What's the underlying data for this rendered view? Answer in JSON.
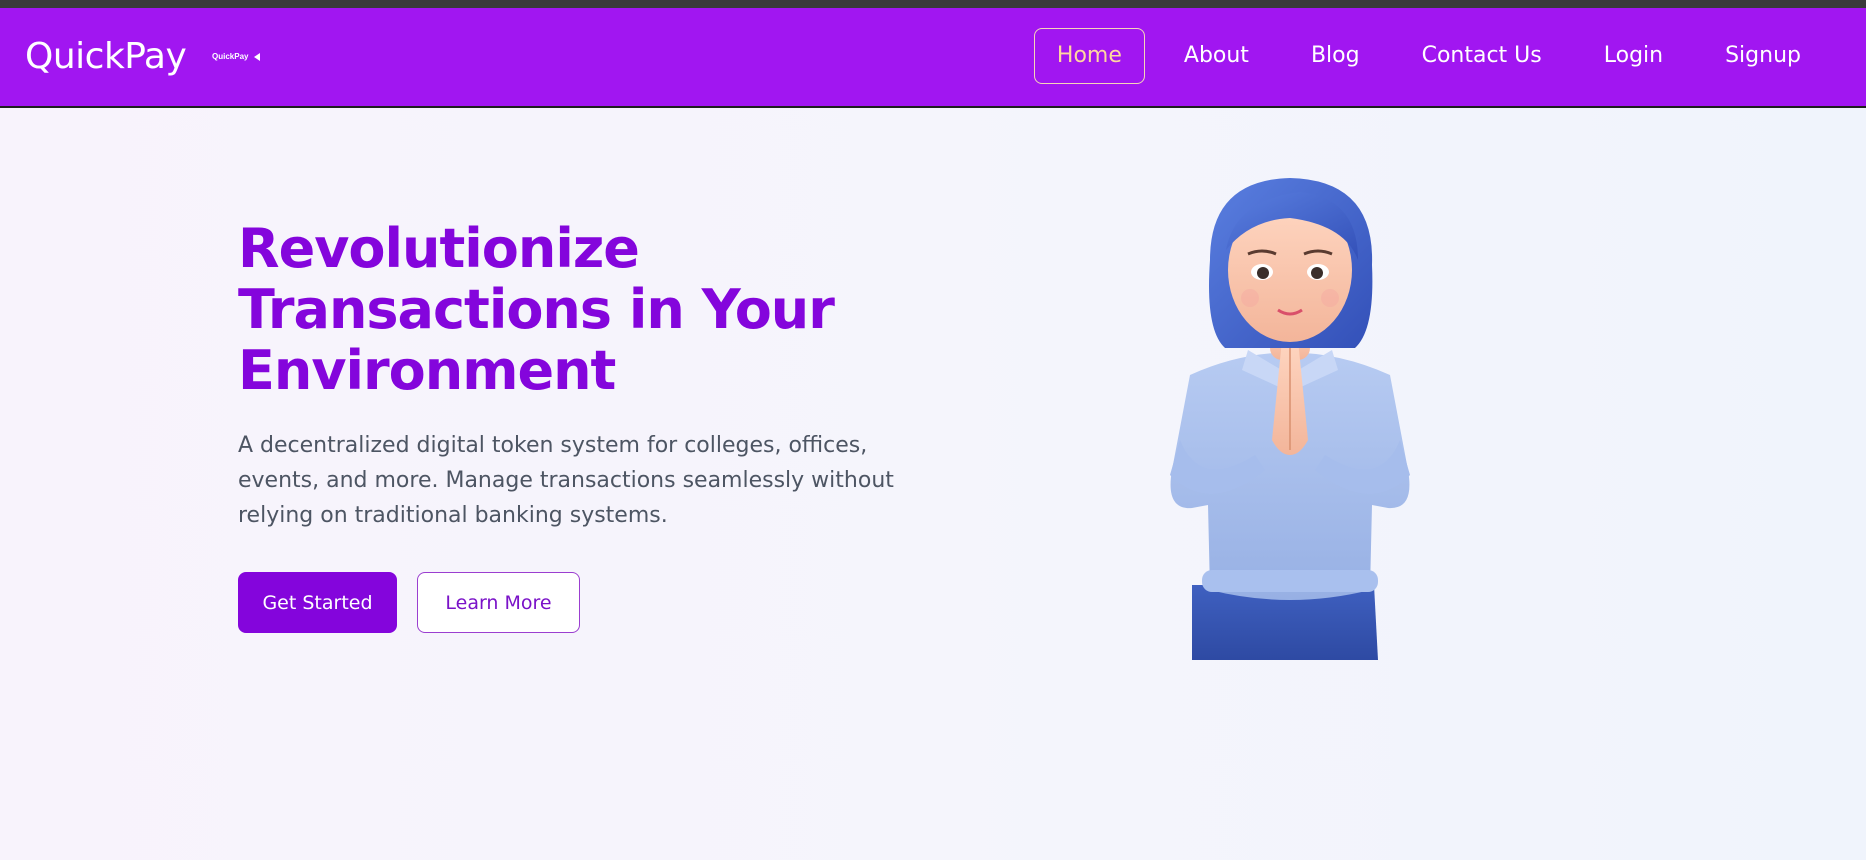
{
  "navbar": {
    "brand": "QuickPay",
    "brand_image_alt": "QuickPay",
    "links": [
      {
        "label": "Home",
        "active": true
      },
      {
        "label": "About"
      },
      {
        "label": "Blog"
      },
      {
        "label": "Contact Us"
      },
      {
        "label": "Login"
      },
      {
        "label": "Signup"
      }
    ]
  },
  "hero": {
    "title": "Revolutionize Transactions in Your Environment",
    "description": "A decentralized digital token system for colleges, offices, events, and more. Manage transactions seamlessly without relying on traditional banking systems.",
    "primary_button": "Get Started",
    "secondary_button": "Learn More",
    "illustration": "3d-character-namaste"
  },
  "colors": {
    "navbar_bg": "#a116f1",
    "accent": "#8405dc",
    "active_link": "#ffd6a0",
    "body_text": "#4d5563"
  }
}
